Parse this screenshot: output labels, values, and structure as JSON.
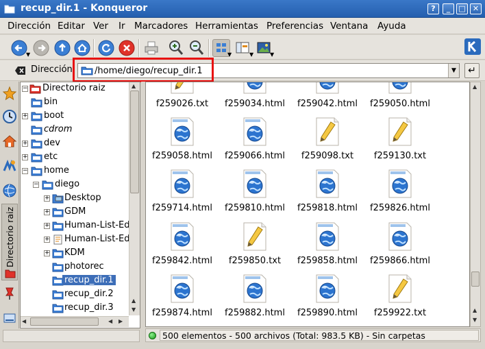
{
  "window": {
    "title": "recup_dir.1 - Konqueror",
    "buttons": [
      "?",
      "_",
      "□",
      "✕"
    ]
  },
  "menubar": {
    "items": [
      "Dirección",
      "Editar",
      "Ver",
      "Ir",
      "Marcadores",
      "Herramientas",
      "Preferencias",
      "Ventana",
      "Ayuda"
    ]
  },
  "location": {
    "label": "Dirección",
    "value": "/home/diego/recup_dir.1"
  },
  "sidebar": {
    "vertical_tab": "Directorio raiz"
  },
  "tree": {
    "items": [
      {
        "label": "Directorio raiz"
      },
      {
        "label": "bin"
      },
      {
        "label": "boot"
      },
      {
        "label": "cdrom"
      },
      {
        "label": "dev"
      },
      {
        "label": "etc"
      },
      {
        "label": "home"
      },
      {
        "label": "diego"
      },
      {
        "label": "Desktop"
      },
      {
        "label": "GDM"
      },
      {
        "label": "Human-List-Ed"
      },
      {
        "label": "Human-List-Ed"
      },
      {
        "label": "KDM"
      },
      {
        "label": "photorec"
      },
      {
        "label": "recup_dir.1"
      },
      {
        "label": "recup_dir.2"
      },
      {
        "label": "recup_dir.3"
      }
    ]
  },
  "files": [
    {
      "name": "f259026.txt",
      "type": "txt"
    },
    {
      "name": "f259034.html",
      "type": "html"
    },
    {
      "name": "f259042.html",
      "type": "html"
    },
    {
      "name": "f259050.html",
      "type": "html"
    },
    {
      "name": "f259058.html",
      "type": "html"
    },
    {
      "name": "f259066.html",
      "type": "html"
    },
    {
      "name": "f259098.txt",
      "type": "txt"
    },
    {
      "name": "f259130.txt",
      "type": "txt"
    },
    {
      "name": "f259714.html",
      "type": "html"
    },
    {
      "name": "f259810.html",
      "type": "html"
    },
    {
      "name": "f259818.html",
      "type": "html"
    },
    {
      "name": "f259826.html",
      "type": "html"
    },
    {
      "name": "f259842.html",
      "type": "html"
    },
    {
      "name": "f259850.txt",
      "type": "txt"
    },
    {
      "name": "f259858.html",
      "type": "html"
    },
    {
      "name": "f259866.html",
      "type": "html"
    },
    {
      "name": "f259874.html",
      "type": "html"
    },
    {
      "name": "f259882.html",
      "type": "html"
    },
    {
      "name": "f259890.html",
      "type": "html"
    },
    {
      "name": "f259922.txt",
      "type": "txt"
    }
  ],
  "status": {
    "text": "500 elementos - 500 archivos (Total: 983.5 KB) - Sin carpetas"
  },
  "colors": {
    "titlebar": "#3a78c8",
    "selection": "#3d6eb8",
    "highlight_box": "#e81010",
    "folder": "#3d7fd6"
  }
}
